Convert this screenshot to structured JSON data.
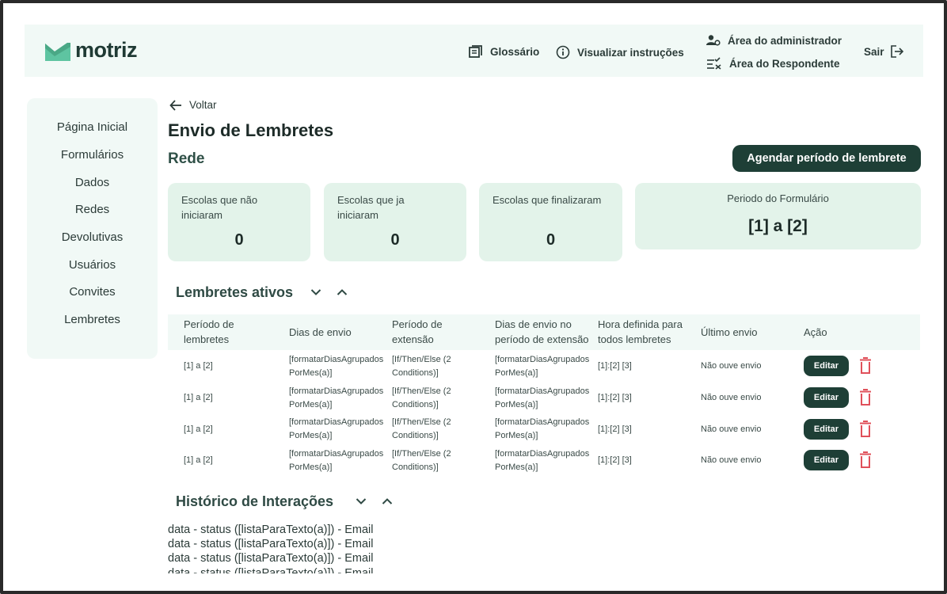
{
  "brand": {
    "name": "motriz",
    "color": "#5ec4a1"
  },
  "header": {
    "glossary": "Glossário",
    "instructions": "Visualizar instruções",
    "admin_area": "Área do administrador",
    "respondent_area": "Área do Respondente",
    "logout": "Sair"
  },
  "sidebar": {
    "items": [
      {
        "label": "Página Inicial"
      },
      {
        "label": "Formulários"
      },
      {
        "label": "Dados"
      },
      {
        "label": "Redes"
      },
      {
        "label": "Devolutivas"
      },
      {
        "label": "Usuários"
      },
      {
        "label": "Convites"
      },
      {
        "label": "Lembretes"
      }
    ]
  },
  "main": {
    "back_label": "Voltar",
    "title": "Envio de Lembretes",
    "subtitle": "Rede",
    "schedule_button": "Agendar período de lembrete",
    "cards": [
      {
        "label": "Escolas que não iniciaram",
        "value": "0"
      },
      {
        "label": "Escolas que ja iniciaram",
        "value": "0"
      },
      {
        "label": "Escolas que finalizaram",
        "value": "0"
      }
    ],
    "form_period": {
      "label": "Periodo do Formulário",
      "value": "[1] a [2]"
    }
  },
  "reminders": {
    "title": "Lembretes ativos",
    "columns": [
      "Período de lembretes",
      "Dias de envio",
      "Período de extensão",
      "Dias de envio no período de extensão",
      "Hora definida para todos lembretes",
      "Último envio",
      "Ação"
    ],
    "rows": [
      {
        "period": "[1] a [2]",
        "days": "[formatarDiasAgrupadosPorMes(a)]",
        "extension": "[If/Then/Else (2 Conditions)]",
        "ext_days": "[formatarDiasAgrupadosPorMes(a)]",
        "hour": "[1]:[2] [3]",
        "last": "Não ouve envio",
        "edit": "Editar"
      },
      {
        "period": "[1] a [2]",
        "days": "[formatarDiasAgrupadosPorMes(a)]",
        "extension": "[If/Then/Else (2 Conditions)]",
        "ext_days": "[formatarDiasAgrupadosPorMes(a)]",
        "hour": "[1]:[2] [3]",
        "last": "Não ouve envio",
        "edit": "Editar"
      },
      {
        "period": "[1] a [2]",
        "days": "[formatarDiasAgrupadosPorMes(a)]",
        "extension": "[If/Then/Else (2 Conditions)]",
        "ext_days": "[formatarDiasAgrupadosPorMes(a)]",
        "hour": "[1]:[2] [3]",
        "last": "Não ouve envio",
        "edit": "Editar"
      },
      {
        "period": "[1] a [2]",
        "days": "[formatarDiasAgrupadosPorMes(a)]",
        "extension": "[If/Then/Else (2 Conditions)]",
        "ext_days": "[formatarDiasAgrupadosPorMes(a)]",
        "hour": "[1]:[2] [3]",
        "last": "Não ouve envio",
        "edit": "Editar"
      }
    ]
  },
  "history": {
    "title": "Histórico de Interações",
    "lines": [
      "data - status ([listaParaTexto(a)]) - Email",
      "data - status ([listaParaTexto(a)]) - Email",
      "data - status ([listaParaTexto(a)]) - Email",
      "data - status ([listaParaTexto(a)]) - Email"
    ]
  }
}
